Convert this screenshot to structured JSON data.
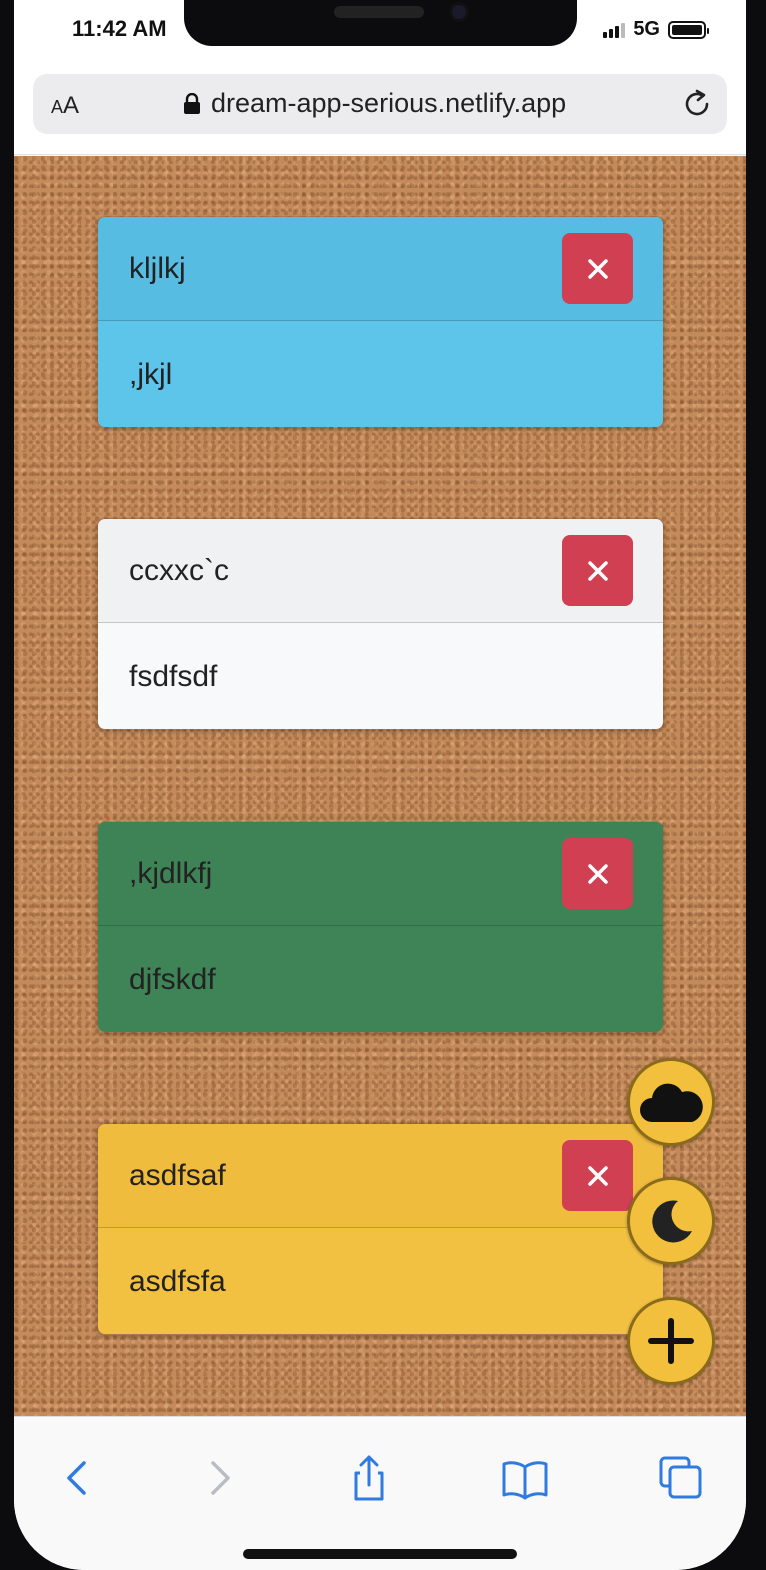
{
  "status_bar": {
    "time": "11:42 AM",
    "network": "5G"
  },
  "browser": {
    "text_size_label_small": "A",
    "text_size_label_big": "A",
    "url": "dream-app-serious.netlify.app"
  },
  "notes": [
    {
      "title": "kljlkj",
      "body": ",jkjl",
      "color": "#5dc5ea"
    },
    {
      "title": "ccxxc`c",
      "body": "fsdfsdf",
      "color": "#f8f9fa"
    },
    {
      "title": ",kjdlkfj",
      "body": "djfskdf",
      "color": "#3f8457"
    },
    {
      "title": "asdfsaf",
      "body": "asdfsfa",
      "color": "#f3c142"
    }
  ],
  "delete_icon": "close-icon",
  "fabs": [
    {
      "icon": "cloud-icon"
    },
    {
      "icon": "moon-icon"
    },
    {
      "icon": "plus-icon"
    }
  ],
  "colors": {
    "accent_fab": "#f2c03c",
    "delete": "#d14052",
    "link_blue": "#2f7be0"
  }
}
